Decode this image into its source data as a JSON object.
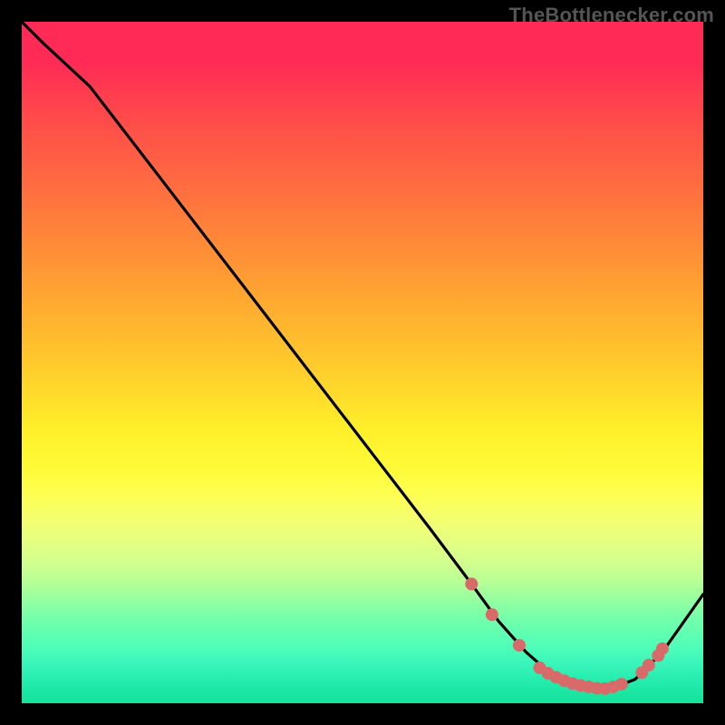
{
  "watermark": "TheBottlenecker.com",
  "chart_data": {
    "type": "line",
    "title": "",
    "xlabel": "",
    "ylabel": "",
    "xlim": [
      0,
      100
    ],
    "ylim": [
      0,
      100
    ],
    "series": [
      {
        "name": "curve",
        "x": [
          0,
          3,
          10,
          20,
          30,
          40,
          50,
          60,
          66,
          70,
          74,
          78,
          82,
          86,
          90,
          94,
          100
        ],
        "y": [
          100,
          97,
          90.5,
          77.5,
          64.5,
          51.5,
          38.5,
          25.5,
          17.5,
          12,
          7.5,
          4,
          2.3,
          2.0,
          3.5,
          7.5,
          16
        ]
      }
    ],
    "markers": {
      "name": "dots",
      "color": "#d96a6a",
      "radius_px": 7,
      "points_xy": [
        [
          66.0,
          17.5
        ],
        [
          69.0,
          13.0
        ],
        [
          73.0,
          8.5
        ],
        [
          76.0,
          5.2
        ],
        [
          77.2,
          4.4
        ],
        [
          78.4,
          3.8
        ],
        [
          79.6,
          3.3
        ],
        [
          80.8,
          2.9
        ],
        [
          82.0,
          2.6
        ],
        [
          83.2,
          2.4
        ],
        [
          84.4,
          2.2
        ],
        [
          85.6,
          2.15
        ],
        [
          86.8,
          2.4
        ],
        [
          88.0,
          2.8
        ],
        [
          91.0,
          4.5
        ],
        [
          92.0,
          5.6
        ],
        [
          93.4,
          7.0
        ],
        [
          94.0,
          8.0
        ]
      ]
    },
    "gradient_stops": [
      {
        "pos": 0.0,
        "color": "#ff2b56"
      },
      {
        "pos": 0.7,
        "color": "#fdff57"
      },
      {
        "pos": 1.0,
        "color": "#14e29a"
      }
    ]
  }
}
